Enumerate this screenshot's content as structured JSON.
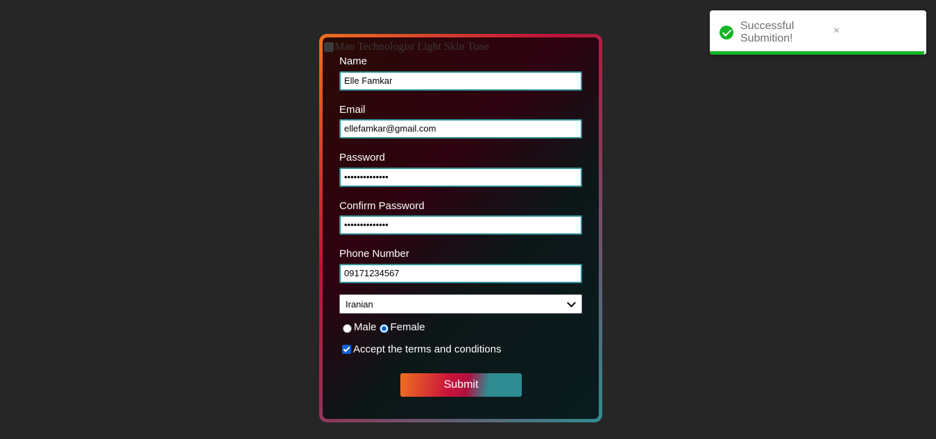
{
  "image_alt": "Man Technologist Light Skin Tone",
  "form": {
    "name": {
      "label": "Name",
      "value": "Elle Famkar"
    },
    "email": {
      "label": "Email",
      "value": "ellefamkar@gmail.com"
    },
    "password": {
      "label": "Password",
      "value": "••••••••••••••"
    },
    "confirm_password": {
      "label": "Confirm Password",
      "value": "••••••••••••••"
    },
    "phone": {
      "label": "Phone Number",
      "value": "09171234567"
    },
    "nationality": {
      "selected": "Iranian"
    },
    "gender": {
      "options": [
        {
          "label": "Male",
          "checked": false
        },
        {
          "label": "Female",
          "checked": true
        }
      ]
    },
    "terms": {
      "label": "Accept the terms and conditions",
      "checked": true
    },
    "submit_label": "Submit"
  },
  "toast": {
    "message": "Successful Submition!",
    "close_glyph": "×",
    "progress": 0.99,
    "icon": "check-circle-icon"
  },
  "colors": {
    "background": "#262626",
    "success": "#17b526",
    "input_border": "#2f8f95",
    "gradient_orange": "#f07020",
    "gradient_red": "#c0123a",
    "gradient_teal": "#2f8c92"
  }
}
